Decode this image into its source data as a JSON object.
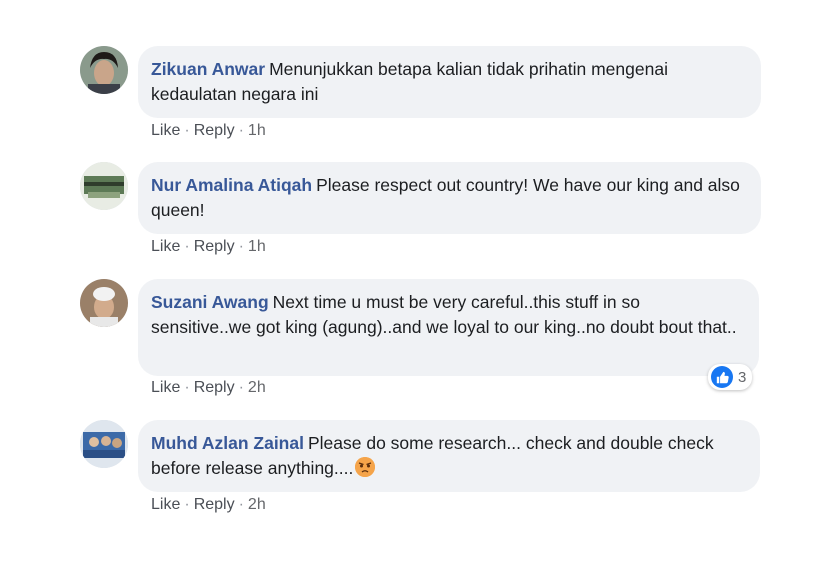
{
  "actions": {
    "like": "Like",
    "reply": "Reply",
    "separator": "·"
  },
  "comments": [
    {
      "author": "Zikuan Anwar",
      "text": "Menunjukkan betapa kalian tidak prihatin mengenai kedaulatan negara ini",
      "time": "1h"
    },
    {
      "author": "Nur Amalina Atiqah",
      "text": "Please respect out country! We have our king and also queen!",
      "time": "1h"
    },
    {
      "author": "Suzani Awang",
      "text": "Next time u must be very careful..this stuff in so sensitive..we got king (agung)..and we loyal to our king..no doubt bout that..",
      "time": "2h",
      "reaction_count": "3"
    },
    {
      "author": "Muhd Azlan Zainal",
      "text": "Please do some research... check and double check before release anything....",
      "time": "2h"
    }
  ],
  "colors": {
    "author": "#385898",
    "bubble": "#f0f2f5",
    "like_blue": "#1877f2"
  }
}
